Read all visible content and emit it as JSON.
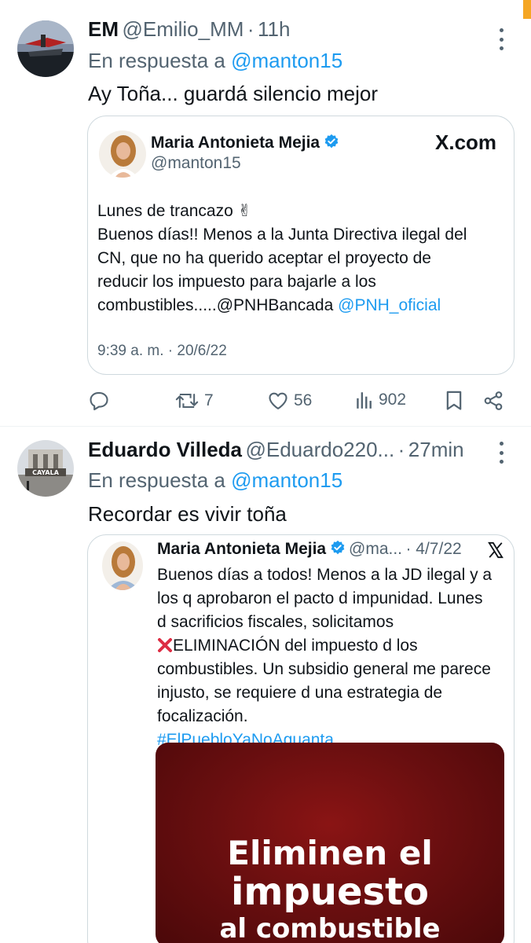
{
  "colors": {
    "link": "#1d9bf0",
    "muted": "#536471",
    "text": "#0f1419",
    "verified": "#1d9bf0",
    "image_red": "#7a1212"
  },
  "tweet1": {
    "name": "EM",
    "handle": "@Emilio_MM",
    "dot": "·",
    "time": "11h",
    "reply_prefix": "En respuesta a",
    "reply_handle": "@manton15",
    "text": "Ay Toña... guardá silencio mejor",
    "quote": {
      "name": "Maria Antonieta Mejia",
      "handle": "@manton15",
      "source": "X.com",
      "lines": [
        "Lunes de trancazo ✌",
        "Buenos días!! Menos a la Junta Directiva ilegal del",
        "CN, que no ha querido aceptar el proyecto de",
        "reducir los impuesto para bajarle a los",
        "combustibles.....@PNHBancada"
      ],
      "mention": "@PNH_oficial",
      "timestamp": "9:39 a. m. · 20/6/22"
    },
    "actions": {
      "retweets": "7",
      "likes": "56",
      "views": "902"
    }
  },
  "tweet2": {
    "name": "Eduardo Villeda",
    "handle": "@Eduardo220...",
    "dot": "·",
    "time": "27min",
    "reply_prefix": "En respuesta a",
    "reply_handle": "@manton15",
    "text": "Recordar es vivir toña",
    "avatar_sign": "CAYALA",
    "quote": {
      "name": "Maria Antonieta Mejia",
      "handle": "@ma...",
      "date": "· 4/7/22",
      "lines": [
        "Buenos días a todos! Menos a la JD ilegal y a",
        "los q aprobaron el pacto d impunidad. Lunes",
        "d sacrificios fiscales, solicitamos"
      ],
      "x_line_rest": "ELIMINACIÓN del impuesto d los",
      "lines2": [
        "combustibles. Un subsidio general me parece",
        "injusto, se requiere d una estrategia de",
        "focalización."
      ],
      "hashtag": "#ElPuebloYaNoAguanta",
      "image_text": [
        "Eliminen el",
        "impuesto",
        "al combustible"
      ]
    }
  }
}
